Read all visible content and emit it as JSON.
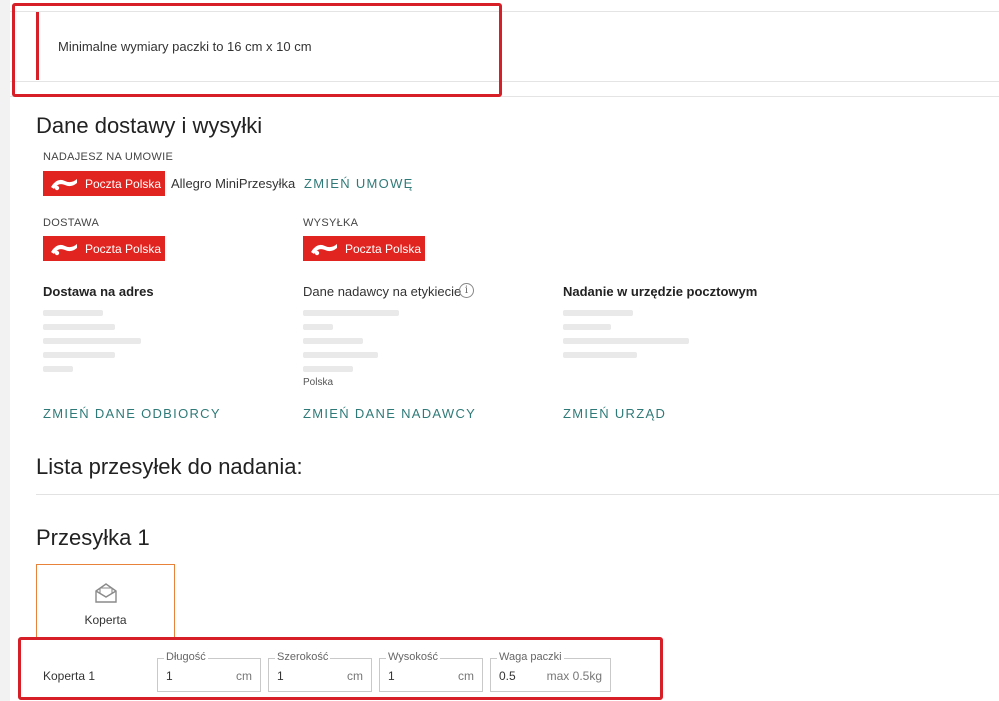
{
  "notice": {
    "text": "Minimalne wymiary paczki to 16 cm x 10 cm"
  },
  "delivery": {
    "title": "Dane dostawy i wysyłki",
    "contract_label": "NADAJESZ NA UMOWIE",
    "contract_name": "Allegro MiniPrzesyłka",
    "change_contract": "ZMIEŃ UMOWĘ",
    "brand": "Poczta Polska",
    "dostawa_label": "DOSTAWA",
    "wysylka_label": "WYSYŁKA",
    "address_title": "Dostawa na adres",
    "sender_title": "Dane nadawcy na etykiecie",
    "office_title": "Nadanie w urzędzie pocztowym",
    "sender_country": "Polska",
    "change_recipient": "ZMIEŃ DANE ODBIORCY",
    "change_sender": "ZMIEŃ DANE NADAWCY",
    "change_office": "ZMIEŃ URZĄD"
  },
  "list": {
    "title": "Lista przesyłek do nadania:"
  },
  "shipment": {
    "title": "Przesyłka 1",
    "package_type": "Koperta",
    "row_label": "Koperta 1",
    "fields": {
      "length": {
        "legend": "Długość",
        "value": "1",
        "unit": "cm"
      },
      "width": {
        "legend": "Szerokość",
        "value": "1",
        "unit": "cm"
      },
      "height": {
        "legend": "Wysokość",
        "value": "1",
        "unit": "cm"
      },
      "weight": {
        "legend": "Waga paczki",
        "value": "0.5",
        "unit": "max 0.5kg"
      }
    }
  },
  "colors": {
    "brand_red": "#e1241f",
    "link_teal": "#2f7a78",
    "highlight": "#d61f26",
    "tile_border": "#e8813a"
  }
}
